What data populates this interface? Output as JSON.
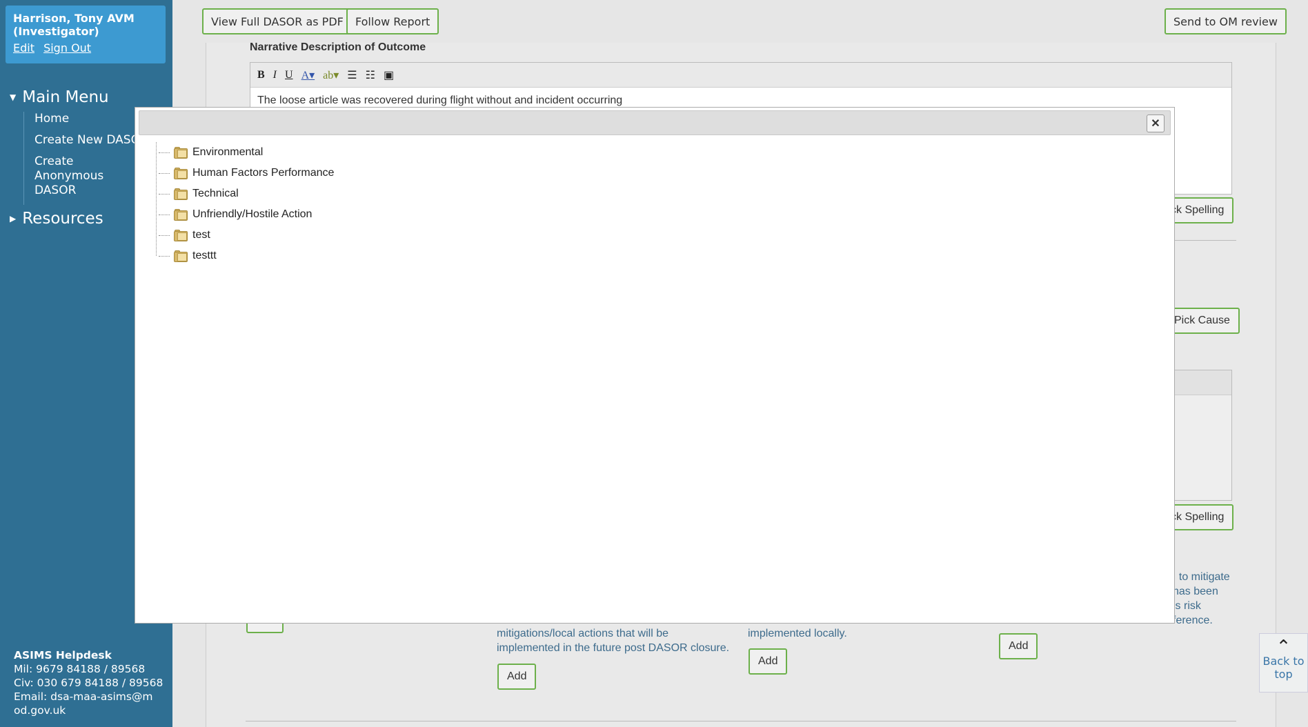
{
  "user": {
    "name": "Harrison, Tony AVM (Investigator)",
    "edit_label": "Edit",
    "signout_label": "Sign Out"
  },
  "main_menu": {
    "title": "Main Menu",
    "items": [
      "Home",
      "Create New DASOR",
      "Create Anonymous DASOR"
    ]
  },
  "resources": {
    "title": "Resources"
  },
  "helpdesk": {
    "title": "ASIMS Helpdesk",
    "mil": "Mil: 9679 84188 / 89568",
    "civ": "Civ: 030 679 84188 / 89568",
    "email_label": "Email:",
    "email": "dsa-maa-asims@mod.gov.uk"
  },
  "toolbar": {
    "pdf": "View Full DASOR as PDF",
    "follow": "Follow Report",
    "send": "Send to OM review"
  },
  "narrative": {
    "label": "Narrative Description of Outcome",
    "text": "The loose article was recovered during flight without and incident occurring"
  },
  "buttons": {
    "spelling1": "ck Spelling",
    "pick_cause": "Pick Cause",
    "spelling2": "ck Spelling",
    "add": "Add"
  },
  "snippets": {
    "col2": "mitigations/local actions that will be implemented in the future post DASOR closure.",
    "col3": "implemented locally.",
    "col4": ". to mitigate\nhas been\nis risk\nference."
  },
  "back_to_top": "Back to top",
  "modal": {
    "tree_items": [
      "Environmental",
      "Human Factors Performance",
      "Technical",
      "Unfriendly/Hostile Action",
      "test",
      "testtt"
    ]
  },
  "icons": {
    "close": "close-icon",
    "folder": "folder-icon",
    "chevron": "chevron-up-icon"
  }
}
